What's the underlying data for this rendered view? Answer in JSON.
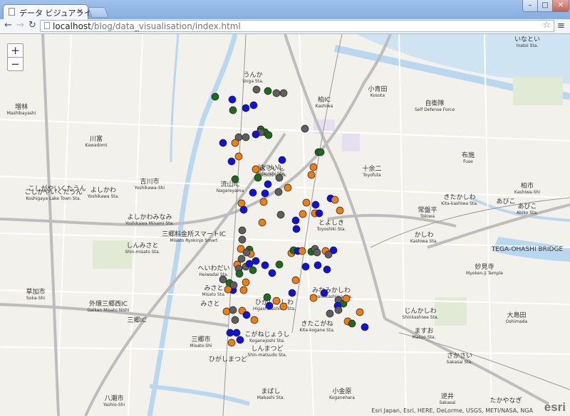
{
  "browser": {
    "tab_title": "データ ビジュアライゼ",
    "tab_close": "×",
    "url_scheme": "",
    "url_host": "localhost",
    "url_path": "/blog/data_visualisation/index.html",
    "window_min": "–",
    "window_max": "□",
    "window_close": "✕",
    "menu": "≡",
    "star": "☆"
  },
  "map": {
    "zoom_in": "+",
    "zoom_out": "−",
    "attribution": "Esri Japan, Esri, HERE, DeLorme, USGS, METI/NASA, NGA",
    "logo": "esri",
    "colors": {
      "green": "#1e6b1e",
      "blue": "#1010e0",
      "orange": "#f07d0e",
      "gray": "#5f5f5f",
      "water": "#b9d8ef",
      "park": "#e0ead5",
      "road": "#ffffff",
      "highway": "#bdbdbd"
    },
    "labels": [
      {
        "t": "うんか",
        "s": "Unga Sta."
      },
      {
        "t": "増林",
        "s": "Mashibayashi"
      },
      {
        "t": "小青田",
        "s": "Kosota"
      },
      {
        "t": "自衛隊",
        "s": "Self Defense Force"
      },
      {
        "t": "川富",
        "s": "Kawadomi"
      },
      {
        "t": "吉川市",
        "s": "Yoshikawa-Shi"
      },
      {
        "t": "こしがやいくたうん",
        "s": "Koshigaya Lake Town Sta."
      },
      {
        "t": "よしかわ",
        "s": "Yoshikawa Sta."
      },
      {
        "t": "よしかわみなみ",
        "s": "Yoshikawa Minami Sta."
      },
      {
        "t": "しんみさと",
        "s": "Shin-misato Sta."
      },
      {
        "t": "三郷料金所スマートIC",
        "s": "Misato Ryokinjo Smart"
      },
      {
        "t": "流山IC",
        "s": "Nagareyama"
      },
      {
        "t": "はついし",
        "s": "Hatsuishi Sta."
      },
      {
        "t": "十余二",
        "s": "Toyofuta"
      },
      {
        "t": "布施",
        "s": "Fuse"
      },
      {
        "t": "柏市",
        "s": "Kashiwa-Shi"
      },
      {
        "t": "きたかしわ",
        "s": "Kita-kashiwa Sta."
      },
      {
        "t": "あびこ",
        "s": "Abiko Sta."
      },
      {
        "t": "かしわ",
        "s": "Kashiwa Sta."
      },
      {
        "t": "とよしき",
        "s": "Toyoshiki Sta."
      },
      {
        "t": "へいわだい",
        "s": "Heiwadai Sta."
      },
      {
        "t": "みさと",
        "s": "Misato Sta."
      },
      {
        "t": "草加市",
        "s": "Soka-Shi"
      },
      {
        "t": "外環三郷西IC",
        "s": "Gaikan Misato Nishi"
      },
      {
        "t": "三郷IC",
        "s": ""
      },
      {
        "t": "三郷市",
        "s": "Misato-Shi"
      },
      {
        "t": "みなみかしわ",
        "s": "Minamikashiwa Sta."
      },
      {
        "t": "きたこがね",
        "s": "Kita-kogane Sta."
      },
      {
        "t": "じんかしわ",
        "s": "Shinkashiwa Sta."
      },
      {
        "t": "ますお",
        "s": "Masuo Sta."
      },
      {
        "t": "さかさい",
        "s": "Sakasai Sta."
      },
      {
        "t": "こがねじょうし",
        "s": "Koganejoshi Sta."
      },
      {
        "t": "しんまつど",
        "s": "Shin-matsudo Sta."
      },
      {
        "t": "まばし",
        "s": "Mabashi Sta."
      },
      {
        "t": "小金原",
        "s": "Koganehara"
      },
      {
        "t": "八潮市",
        "s": "Yashio-Shi"
      },
      {
        "t": "逆井",
        "s": "Sakasai"
      },
      {
        "t": "大島田",
        "s": "Oshimada"
      },
      {
        "t": "いなとい",
        "s": "Inatoi Sta."
      },
      {
        "t": "たかやなぎ",
        "s": ""
      },
      {
        "t": "柏IC",
        "s": "Kashiwa"
      },
      {
        "t": "TEGA-OHASHI BRIDGE",
        "s": ""
      },
      {
        "t": "妙見寺",
        "s": "Myoken-ji Temple"
      },
      {
        "t": "常盤平",
        "s": "Tokiwa"
      },
      {
        "t": "あびこ",
        "s": ""
      },
      {
        "t": "ひがしかしわ",
        "s": "Higashikashiwa Sta."
      },
      {
        "t": "はついし",
        "s": "Hatsuishi Sta."
      },
      {
        "t": "こしがやいくたうん",
        "s": ""
      },
      {
        "t": "みさと",
        "s": ""
      },
      {
        "t": "ひがしまつど",
        "s": ""
      }
    ],
    "dots": [
      [
        "green",
        302,
        136
      ],
      [
        "blue",
        326,
        140
      ],
      [
        "gray",
        360,
        126
      ],
      [
        "green",
        376,
        128
      ],
      [
        "gray",
        388,
        131
      ],
      [
        "gray",
        398,
        131
      ],
      [
        "green",
        327,
        155
      ],
      [
        "blue",
        345,
        152
      ],
      [
        "blue",
        356,
        148
      ],
      [
        "green",
        366,
        182
      ],
      [
        "blue",
        313,
        201
      ],
      [
        "gray",
        335,
        193
      ],
      [
        "gray",
        345,
        193
      ],
      [
        "orange",
        330,
        201
      ],
      [
        "green",
        372,
        186
      ],
      [
        "gray",
        366,
        186
      ],
      [
        "green",
        377,
        190
      ],
      [
        "gray",
        428,
        181
      ],
      [
        "blue",
        359,
        189
      ],
      [
        "green",
        447,
        214
      ],
      [
        "green",
        450,
        214
      ],
      [
        "orange",
        335,
        220
      ],
      [
        "blue",
        396,
        225
      ],
      [
        "blue",
        325,
        227
      ],
      [
        "orange",
        359,
        238
      ],
      [
        "orange",
        440,
        235
      ],
      [
        "orange",
        437,
        246
      ],
      [
        "green",
        362,
        250
      ],
      [
        "gray",
        392,
        250
      ],
      [
        "green",
        330,
        252
      ],
      [
        "blue",
        376,
        259
      ],
      [
        "blue",
        355,
        271
      ],
      [
        "orange",
        404,
        264
      ],
      [
        "blue",
        372,
        272
      ],
      [
        "gray",
        391,
        270
      ],
      [
        "blue",
        464,
        279
      ],
      [
        "orange",
        370,
        284
      ],
      [
        "orange",
        430,
        285
      ],
      [
        "blue",
        443,
        288
      ],
      [
        "orange",
        470,
        281
      ],
      [
        "orange",
        339,
        286
      ],
      [
        "blue",
        342,
        295
      ],
      [
        "orange",
        477,
        296
      ],
      [
        "gray",
        394,
        302
      ],
      [
        "orange",
        425,
        301
      ],
      [
        "orange",
        442,
        300
      ],
      [
        "blue",
        415,
        310
      ],
      [
        "blue",
        448,
        300
      ],
      [
        "orange",
        368,
        313
      ],
      [
        "gray",
        340,
        324
      ],
      [
        "blue",
        416,
        322
      ],
      [
        "gray",
        340,
        337
      ],
      [
        "orange",
        338,
        350
      ],
      [
        "green",
        350,
        351
      ],
      [
        "gray",
        339,
        364
      ],
      [
        "orange",
        352,
        357
      ],
      [
        "gray",
        346,
        355
      ],
      [
        "orange",
        409,
        356
      ],
      [
        "green",
        412,
        352
      ],
      [
        "blue",
        418,
        353
      ],
      [
        "orange",
        424,
        353
      ],
      [
        "green",
        437,
        354
      ],
      [
        "gray",
        442,
        350
      ],
      [
        "orange",
        457,
        353
      ],
      [
        "blue",
        468,
        352
      ],
      [
        "gray",
        445,
        355
      ],
      [
        "gray",
        461,
        358
      ],
      [
        "orange",
        333,
        372
      ],
      [
        "gray",
        345,
        375
      ],
      [
        "blue",
        350,
        371
      ],
      [
        "gray",
        335,
        378
      ],
      [
        "green",
        336,
        385
      ],
      [
        "blue",
        359,
        367
      ],
      [
        "green",
        355,
        380
      ],
      [
        "blue",
        372,
        373
      ],
      [
        "blue",
        382,
        384
      ],
      [
        "green",
        392,
        372
      ],
      [
        "blue",
        429,
        375
      ],
      [
        "blue",
        446,
        373
      ],
      [
        "blue",
        459,
        379
      ],
      [
        "gray",
        313,
        393
      ],
      [
        "green",
        322,
        398
      ],
      [
        "blue",
        327,
        408
      ],
      [
        "gray",
        328,
        401
      ],
      [
        "orange",
        345,
        397
      ],
      [
        "orange",
        320,
        407
      ],
      [
        "orange",
        342,
        408
      ],
      [
        "orange",
        415,
        394
      ],
      [
        "blue",
        410,
        412
      ],
      [
        "green",
        375,
        418
      ],
      [
        "orange",
        388,
        423
      ],
      [
        "blue",
        378,
        430
      ],
      [
        "orange",
        398,
        431
      ],
      [
        "orange",
        440,
        419
      ],
      [
        "blue",
        455,
        412
      ],
      [
        "gray",
        475,
        422
      ],
      [
        "green",
        482,
        427
      ],
      [
        "blue",
        474,
        430
      ],
      [
        "orange",
        486,
        420
      ],
      [
        "orange",
        318,
        438
      ],
      [
        "gray",
        327,
        436
      ],
      [
        "orange",
        340,
        437
      ],
      [
        "gray",
        330,
        450
      ],
      [
        "orange",
        357,
        450
      ],
      [
        "blue",
        346,
        443
      ],
      [
        "gray",
        463,
        441
      ],
      [
        "gray",
        475,
        436
      ],
      [
        "orange",
        505,
        439
      ],
      [
        "orange",
        488,
        452
      ],
      [
        "green",
        494,
        455
      ],
      [
        "blue",
        512,
        460
      ],
      [
        "blue",
        323,
        468
      ],
      [
        "blue",
        332,
        468
      ],
      [
        "orange",
        325,
        482
      ],
      [
        "blue",
        337,
        478
      ]
    ]
  }
}
